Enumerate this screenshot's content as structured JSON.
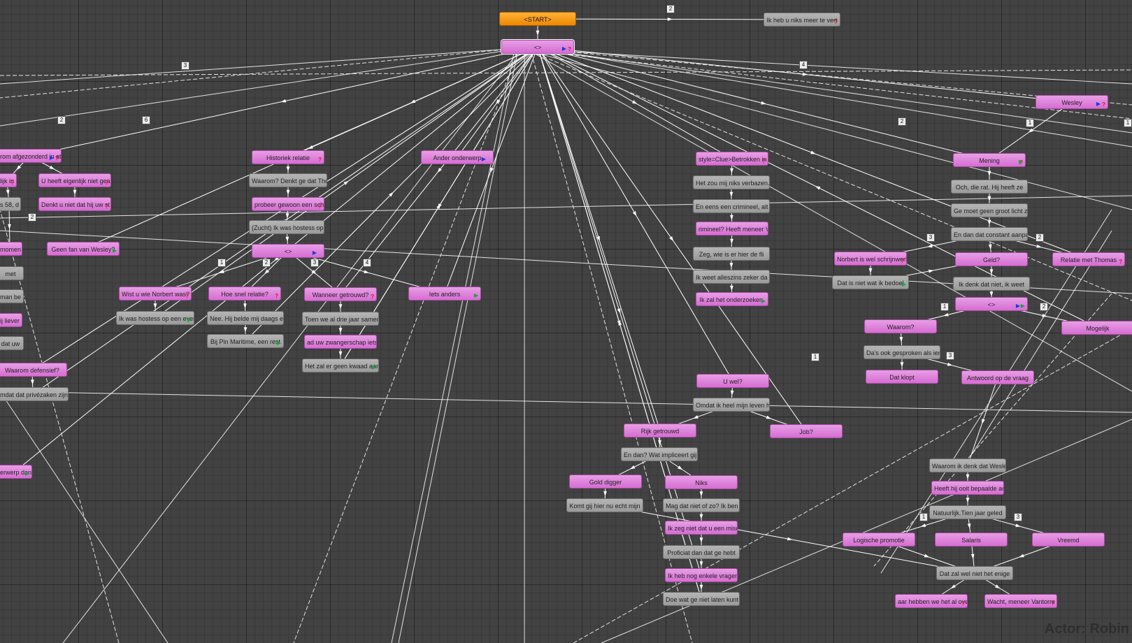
{
  "window": {
    "actor_label": "Actor: Robin"
  },
  "colors": {
    "dialogue_node": "#dd7dda",
    "response_node": "#a9a9a9",
    "start_node": "#f7980f",
    "link_line": "#ffffff",
    "background": "#424242"
  },
  "nodes": [
    {
      "id": "start",
      "text": "<START>",
      "style": "orange"
    },
    {
      "id": "hub",
      "text": "<>",
      "style": "pink",
      "markers": [
        "tri",
        "q"
      ]
    },
    {
      "id": "niks",
      "text": "Ik heb u niks meer te vert",
      "style": "gray",
      "markers": [
        "q"
      ]
    },
    {
      "id": "afgez",
      "text": "rom afgezonderd in ate",
      "style": "pink",
      "markers": [
        "tri",
        "q"
      ]
    },
    {
      "id": "lijkin",
      "text": "lijk in",
      "style": "pink",
      "markers": [
        "q"
      ]
    },
    {
      "id": "eigenlijk",
      "text": "U heeft eigenlijk niet gea",
      "style": "pink",
      "markers": [
        "q"
      ]
    },
    {
      "id": "denkt",
      "text": "Denkt u niet dat hij uw st",
      "style": "pink",
      "markers": [
        "q"
      ]
    },
    {
      "id": "n58",
      "text": "s 58, d",
      "style": "gray"
    },
    {
      "id": "momen",
      "text": "momen",
      "style": "pink"
    },
    {
      "id": "fan",
      "text": "Geen fan van Wesley?",
      "style": "pink",
      "markers": [
        "arr"
      ]
    },
    {
      "id": "met",
      "text": "met",
      "style": "gray"
    },
    {
      "id": "manbe",
      "text": "man be",
      "style": "gray"
    },
    {
      "id": "liever",
      "text": "ij liever",
      "style": "pink"
    },
    {
      "id": "datuw",
      "text": "dat uw",
      "style": "gray"
    },
    {
      "id": "defensief",
      "text": "Waarom defensief?",
      "style": "pink"
    },
    {
      "id": "privezaken",
      "text": "mdat dat privézaken zijn",
      "style": "gray"
    },
    {
      "id": "erwerp",
      "text": "erwerp dan.",
      "style": "pink",
      "markers": [
        "arr"
      ]
    },
    {
      "id": "historiek",
      "text": "Historiek relatie",
      "style": "pink",
      "markers": [
        "q"
      ]
    },
    {
      "id": "thoma",
      "text": "Waarom? Denkt ge dat Thoma",
      "style": "gray"
    },
    {
      "id": "probeer",
      "text": "probeer gewoon een sch",
      "style": "pink",
      "markers": [
        "q"
      ]
    },
    {
      "id": "zucht",
      "text": "(Zucht) Ik was hostess op",
      "style": "gray"
    },
    {
      "id": "hub2",
      "text": "<>",
      "style": "pink",
      "markers": [
        "tri"
      ]
    },
    {
      "id": "wistu",
      "text": "Wist u wie Norbert was?",
      "style": "pink",
      "markers": [
        "q"
      ]
    },
    {
      "id": "hostess",
      "text": "Ik was hostess op een even",
      "style": "gray",
      "markers": [
        "arr"
      ]
    },
    {
      "id": "snel",
      "text": "Hoe snel relatie?",
      "style": "pink",
      "markers": [
        "q"
      ]
    },
    {
      "id": "nee",
      "text": "Nee. Hij belde mij daags e",
      "style": "gray"
    },
    {
      "id": "pin",
      "text": "Bij Pin Maritime, een rest",
      "style": "gray",
      "markers": [
        "arr"
      ]
    },
    {
      "id": "getrouwd",
      "text": "Wanneer getrouwd?",
      "style": "pink",
      "markers": [
        "q"
      ]
    },
    {
      "id": "toen",
      "text": "Toen we al drie jaar samen",
      "style": "gray"
    },
    {
      "id": "zwanger",
      "text": "ad uw zwangerschap iets",
      "style": "pink"
    },
    {
      "id": "kwaad",
      "text": "Het zal er geen kwaad aan",
      "style": "gray",
      "markers": [
        "arr"
      ]
    },
    {
      "id": "anders",
      "text": "Iets anders",
      "style": "pink",
      "markers": [
        "arr"
      ]
    },
    {
      "id": "onderwerp",
      "text": "Ander onderwerp",
      "style": "pink",
      "markers": [
        "tri"
      ]
    },
    {
      "id": "clue",
      "text": "style=Clue>Betrokken in c",
      "style": "pink",
      "markers": [
        "q"
      ]
    },
    {
      "id": "verbazen",
      "text": "Het zou mij niks verbazen.",
      "style": "gray"
    },
    {
      "id": "crimineel",
      "text": "En eens een crimineel, alt",
      "style": "gray"
    },
    {
      "id": "rimineel",
      "text": "rimineel? Heeft meneer Va",
      "style": "pink"
    },
    {
      "id": "zeg",
      "text": "Zeg, wie is er hier de fli",
      "style": "gray"
    },
    {
      "id": "alleszins",
      "text": "Ik weet alleszins zeker da",
      "style": "gray"
    },
    {
      "id": "onderzoeken",
      "text": "Ik zal het onderzoeken.",
      "style": "pink",
      "markers": [
        "arr"
      ]
    },
    {
      "id": "uwel",
      "text": "U wel?",
      "style": "pink"
    },
    {
      "id": "omdat",
      "text": "Omdat ik heel mijn leven h",
      "style": "gray"
    },
    {
      "id": "rijk",
      "text": "Rijk getrouwd",
      "style": "pink"
    },
    {
      "id": "job",
      "text": "Job?",
      "style": "pink"
    },
    {
      "id": "endan",
      "text": "En dan? Wat impliceert gij",
      "style": "gray"
    },
    {
      "id": "gold",
      "text": "Gold digger",
      "style": "pink"
    },
    {
      "id": "nikss",
      "text": "Niks",
      "style": "pink"
    },
    {
      "id": "komt",
      "text": "Komt gij hier nu echt mijn",
      "style": "gray"
    },
    {
      "id": "mag",
      "text": "Mag dat niet of zo? Ik ben",
      "style": "gray"
    },
    {
      "id": "misd",
      "text": "Ik zeg niet dat u een misd",
      "style": "pink"
    },
    {
      "id": "proficiat",
      "text": "Proficiat dan dat ge hebt",
      "style": "gray"
    },
    {
      "id": "vragen",
      "text": "Ik heb nog enkele vragen,",
      "style": "pink"
    },
    {
      "id": "doe",
      "text": "Doe wat ge niet laten kunt",
      "style": "gray"
    },
    {
      "id": "wesley",
      "text": "Wesley",
      "style": "pink",
      "markers": [
        "tri",
        "q"
      ]
    },
    {
      "id": "mening",
      "text": "Mening",
      "style": "pink",
      "markers": [
        "q",
        "arr"
      ]
    },
    {
      "id": "rat",
      "text": "Och, die rat. Hij heeft ze",
      "style": "gray"
    },
    {
      "id": "licht",
      "text": "Ge moet geen groot licht z",
      "style": "gray"
    },
    {
      "id": "constant",
      "text": "En dan dat constant aanpap",
      "style": "gray"
    },
    {
      "id": "schrijnwerk",
      "text": "Norbert is wel schrijnwerk",
      "style": "pink",
      "markers": [
        "q"
      ]
    },
    {
      "id": "geld",
      "text": "Geld?",
      "style": "pink"
    },
    {
      "id": "thomas",
      "text": "Relatie met Thomas",
      "style": "pink",
      "markers": [
        "q"
      ]
    },
    {
      "id": "bedoel",
      "text": "Dat is niet wat ik bedoel",
      "style": "gray",
      "markers": [
        "arr"
      ]
    },
    {
      "id": "denkniet",
      "text": "Ik denk dat niet, ik weet",
      "style": "gray"
    },
    {
      "id": "hub3",
      "text": "<>",
      "style": "pink",
      "markers": [
        "tri",
        "arr"
      ]
    },
    {
      "id": "waarom",
      "text": "Waarom?",
      "style": "pink"
    },
    {
      "id": "mogelijk",
      "text": "Mogelijk",
      "style": "pink"
    },
    {
      "id": "gesproken",
      "text": "Da's ook gesproken als iem",
      "style": "gray"
    },
    {
      "id": "klopt",
      "text": "Dat klopt",
      "style": "pink"
    },
    {
      "id": "antwoord",
      "text": "Antwoord op de vraag",
      "style": "pink"
    },
    {
      "id": "waaromwesley",
      "text": "Waarom ik denk dat Wesley",
      "style": "gray"
    },
    {
      "id": "ooit",
      "text": "Heeft hij ooit bepaalde ac",
      "style": "pink"
    },
    {
      "id": "natuurlijk",
      "text": "Natuurlijk.Tien jaar geled",
      "style": "gray"
    },
    {
      "id": "logische",
      "text": "Logische promotie",
      "style": "pink"
    },
    {
      "id": "salaris",
      "text": "Salaris",
      "style": "pink"
    },
    {
      "id": "vreemd",
      "text": "Vreemd",
      "style": "pink"
    },
    {
      "id": "enige",
      "text": "Dat zal wel niet het enige",
      "style": "gray"
    },
    {
      "id": "hebben",
      "text": "aar hebben we het al ove",
      "style": "pink",
      "markers": [
        "q"
      ]
    },
    {
      "id": "vantorre",
      "text": "Wacht, meneer Vantorre ga",
      "style": "pink",
      "markers": [
        "q"
      ]
    }
  ],
  "badges": [
    {
      "id": "b1",
      "text": "2"
    },
    {
      "id": "b2",
      "text": "3"
    },
    {
      "id": "b3",
      "text": "4"
    },
    {
      "id": "b4",
      "text": "2"
    },
    {
      "id": "b5",
      "text": "6"
    },
    {
      "id": "b6",
      "text": "2"
    },
    {
      "id": "b7",
      "text": "1"
    },
    {
      "id": "b8",
      "text": "2"
    },
    {
      "id": "b9",
      "text": "3"
    },
    {
      "id": "b10",
      "text": "4"
    },
    {
      "id": "b11",
      "text": "2"
    },
    {
      "id": "b12",
      "text": "1"
    },
    {
      "id": "b13",
      "text": "1"
    },
    {
      "id": "b14",
      "text": "3"
    },
    {
      "id": "b15",
      "text": "2"
    },
    {
      "id": "b16",
      "text": "1"
    },
    {
      "id": "b17",
      "text": "2"
    },
    {
      "id": "b18",
      "text": "1"
    },
    {
      "id": "b19",
      "text": "3"
    },
    {
      "id": "b20",
      "text": "1"
    },
    {
      "id": "b21",
      "text": "3"
    }
  ]
}
